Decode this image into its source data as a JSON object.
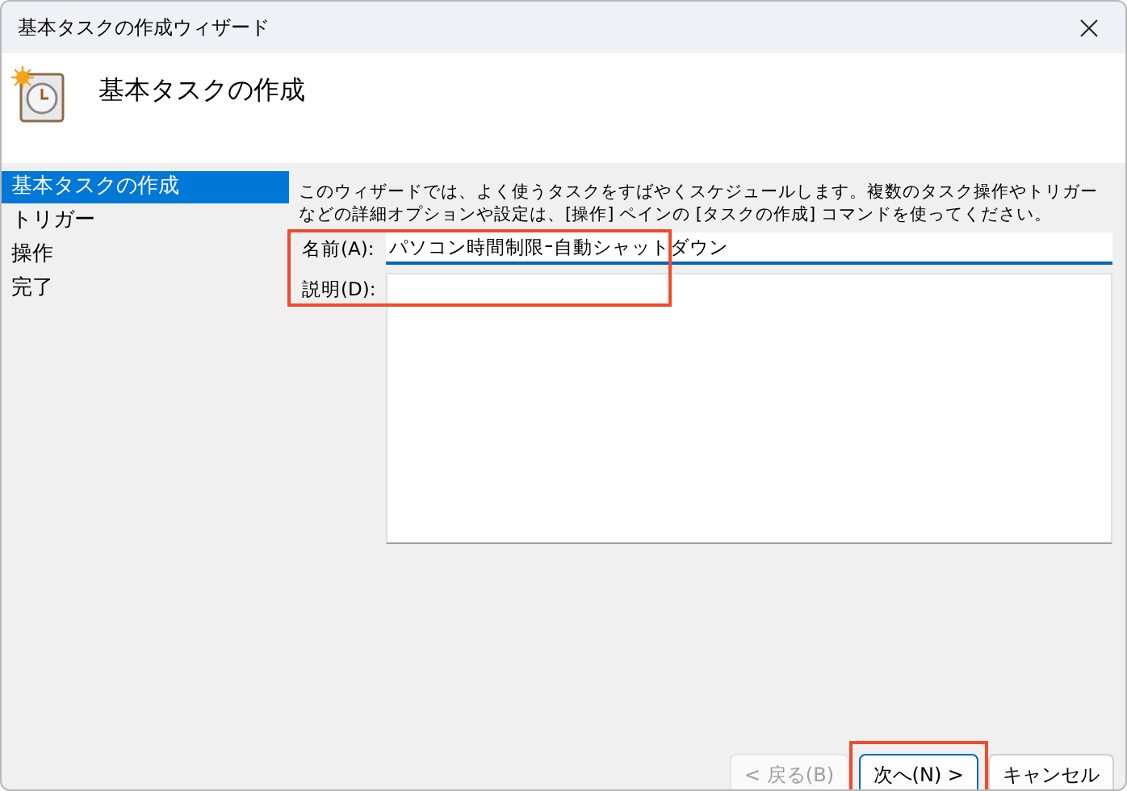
{
  "window": {
    "title": "基本タスクの作成ウィザード"
  },
  "header": {
    "title": "基本タスクの作成"
  },
  "sidebar": {
    "items": [
      {
        "label": "基本タスクの作成",
        "selected": true
      },
      {
        "label": "トリガー",
        "selected": false
      },
      {
        "label": "操作",
        "selected": false
      },
      {
        "label": "完了",
        "selected": false
      }
    ]
  },
  "intro": "このウィザードでは、よく使うタスクをすばやくスケジュールします。複数のタスク操作やトリガーなどの詳細オプションや設定は、[操作] ペインの [タスクの作成] コマンドを使ってください。",
  "fields": {
    "highlighted": true,
    "name": {
      "label": "名前(A):",
      "value": "パソコン時間制限ｰ自動シャットダウン"
    },
    "description": {
      "label": "説明(D):"
    }
  },
  "buttons": [
    {
      "label": "< 戻る(B)",
      "disabled": true,
      "highlighted": false,
      "default": false
    },
    {
      "label": "次へ(N) >",
      "disabled": false,
      "highlighted": true,
      "default": true
    },
    {
      "label": "キャンセル",
      "disabled": false,
      "highlighted": false,
      "default": false
    }
  ]
}
